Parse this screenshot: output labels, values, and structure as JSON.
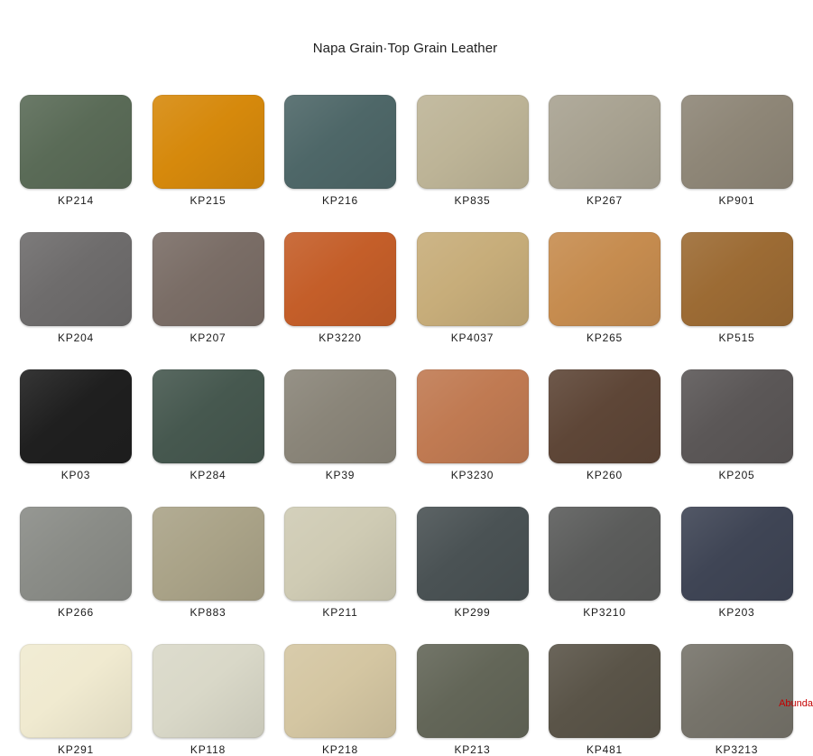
{
  "title": "Napa Grain·Top Grain Leather",
  "swatches": [
    {
      "code": "KP214",
      "color": "#5a6b57"
    },
    {
      "code": "KP215",
      "color": "#d6890c"
    },
    {
      "code": "KP216",
      "color": "#4e6768"
    },
    {
      "code": "KP835",
      "color": "#bdb497"
    },
    {
      "code": "KP267",
      "color": "#a8a291"
    },
    {
      "code": "KP901",
      "color": "#8e8677"
    },
    {
      "code": "KP204",
      "color": "#6e6c6c"
    },
    {
      "code": "KP207",
      "color": "#7a6d66"
    },
    {
      "code": "KP3220",
      "color": "#c45e29"
    },
    {
      "code": "KP4037",
      "color": "#c7ad7a"
    },
    {
      "code": "KP265",
      "color": "#c68c4f"
    },
    {
      "code": "KP515",
      "color": "#9c6b34"
    },
    {
      "code": "KP03",
      "color": "#1f1f1f"
    },
    {
      "code": "KP284",
      "color": "#46584f"
    },
    {
      "code": "KP39",
      "color": "#8a8579"
    },
    {
      "code": "KP3230",
      "color": "#c07a52"
    },
    {
      "code": "KP260",
      "color": "#5e4637"
    },
    {
      "code": "KP205",
      "color": "#5b5757"
    },
    {
      "code": "KP266",
      "color": "#8a8c87"
    },
    {
      "code": "KP883",
      "color": "#aaa388"
    },
    {
      "code": "KP211",
      "color": "#cfcbb4"
    },
    {
      "code": "KP299",
      "color": "#4a5254"
    },
    {
      "code": "KP3210",
      "color": "#5b5c5b"
    },
    {
      "code": "KP203",
      "color": "#3f4555"
    },
    {
      "code": "KP291",
      "color": "#f0ead0"
    },
    {
      "code": "KP118",
      "color": "#d9d8c8"
    },
    {
      "code": "KP218",
      "color": "#d4c6a2"
    },
    {
      "code": "KP213",
      "color": "#636658"
    },
    {
      "code": "KP481",
      "color": "#5a5448"
    },
    {
      "code": "KP3213",
      "color": "#76736a"
    }
  ],
  "watermark": "Abunda"
}
